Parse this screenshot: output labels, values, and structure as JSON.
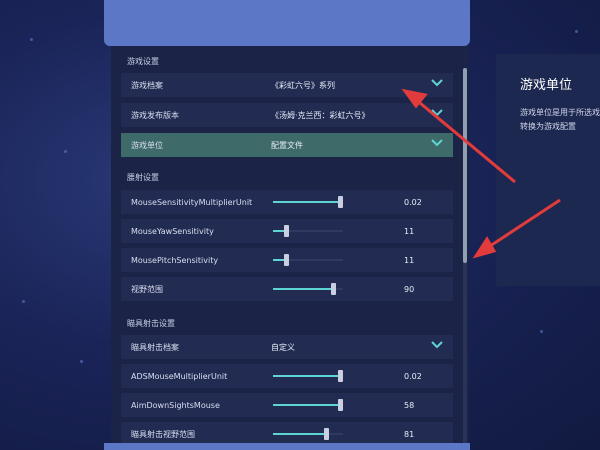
{
  "settings": {
    "game_settings": {
      "section_title": "游戏设置",
      "rows": [
        {
          "label": "游戏档案",
          "value": "《彩虹六号》系列"
        },
        {
          "label": "游戏发布版本",
          "value": "《汤姆·克兰西：彩虹六号》"
        },
        {
          "label": "游戏单位",
          "value": "配置文件"
        }
      ]
    },
    "hipfire": {
      "section_title": "腰射设置",
      "rows": [
        {
          "label": "MouseSensitivityMultiplierUnit",
          "value": "0.02",
          "level": 0.95
        },
        {
          "label": "MouseYawSensitivity",
          "value": "11",
          "level": 0.18
        },
        {
          "label": "MousePitchSensitivity",
          "value": "11",
          "level": 0.18
        },
        {
          "label": "视野范围",
          "value": "90",
          "level": 0.85
        }
      ]
    },
    "ads": {
      "section_title": "瞄具射击设置",
      "profile": {
        "label": "瞄具射击档案",
        "value": "自定义"
      },
      "rows": [
        {
          "label": "ADSMouseMultiplierUnit",
          "value": "0.02",
          "level": 0.95
        },
        {
          "label": "AimDownSightsMouse",
          "value": "58",
          "level": 0.95
        },
        {
          "label": "瞄具射击视野范围",
          "value": "81",
          "level": 0.75
        }
      ]
    }
  },
  "info_panel": {
    "title": "游戏单位",
    "description": "游戏单位是用于所选戏，转换为游戏配置"
  },
  "colors": {
    "accent": "#5fd4d4",
    "banner": "#5c77c6",
    "arrow": "#e23b3b"
  }
}
